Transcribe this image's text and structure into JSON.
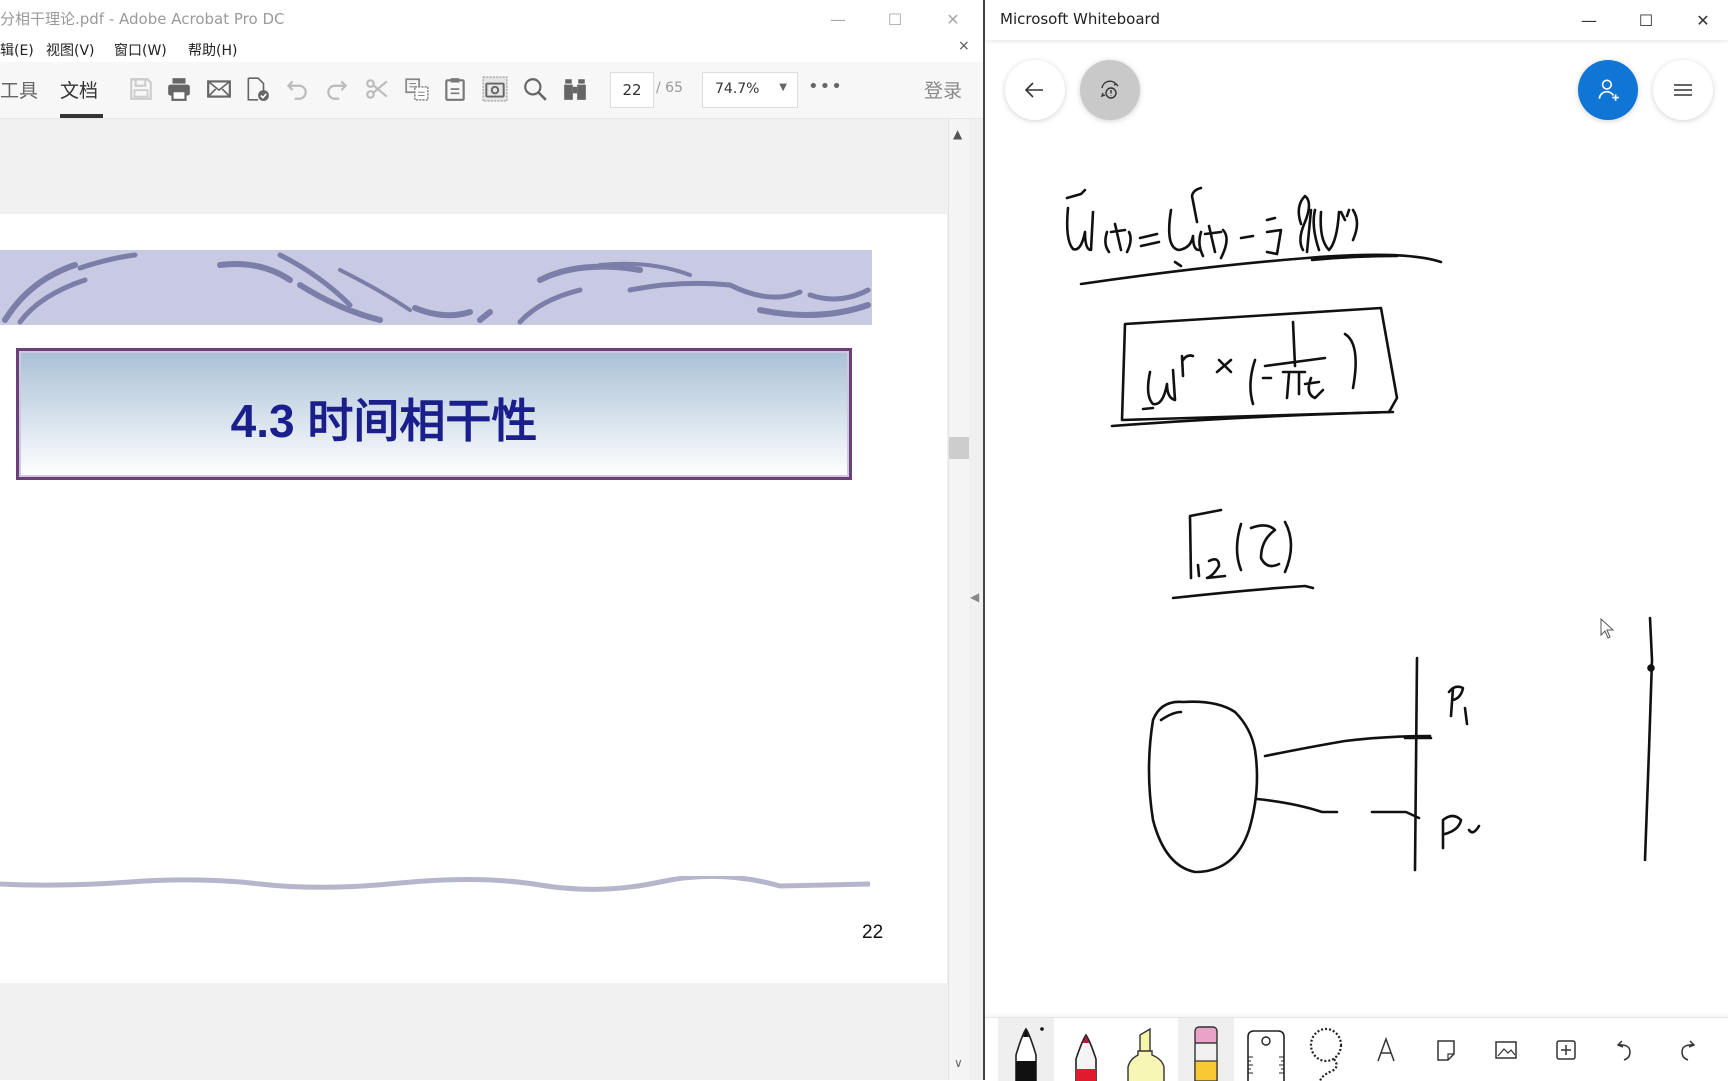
{
  "acrobat": {
    "window_title": "分相干理论.pdf - Adobe Acrobat Pro DC",
    "menu": [
      "辑(E)",
      "视图(V)",
      "窗口(W)",
      "帮助(H)"
    ],
    "tabs": [
      {
        "label": "工具",
        "active": false
      },
      {
        "label": "文档",
        "active": true
      }
    ],
    "toolbar_icons": [
      "save-icon",
      "print-icon",
      "email-icon",
      "sign-icon",
      "undo-icon",
      "redo-icon",
      "cut-icon",
      "copy-icon",
      "paste-icon",
      "snapshot-icon",
      "search-icon",
      "compare-icon"
    ],
    "page_current": "22",
    "page_total": "/ 65",
    "zoom": "74.7%",
    "more": "•••",
    "login": "登录",
    "close_doc": "×",
    "slide": {
      "title": "4.3 时间相干性",
      "page_number": "22"
    },
    "scroll_up": "▲",
    "scroll_down": "∨",
    "collapse": "◀"
  },
  "whiteboard": {
    "window_title": "Microsoft Whiteboard",
    "buttons": {
      "back": "back-arrow",
      "sync": "sync-warning",
      "invite": "invite-person",
      "menu": "hamburger-menu"
    },
    "canvas_ink": {
      "line1": "ũ(t) = u^r(t) − j·H{u^r}",
      "boxed": "u^r ∗ (−1/πt)",
      "gamma": "Γ12(τ)",
      "labels": [
        "P1",
        "P2"
      ]
    },
    "tools": [
      "pen-black",
      "pen-red",
      "highlighter-yellow",
      "eraser",
      "ruler",
      "lasso",
      "text",
      "sticky-note",
      "image",
      "add",
      "undo",
      "redo"
    ]
  },
  "window_controls": {
    "minimize": "—",
    "maximize": "☐",
    "close": "✕"
  }
}
